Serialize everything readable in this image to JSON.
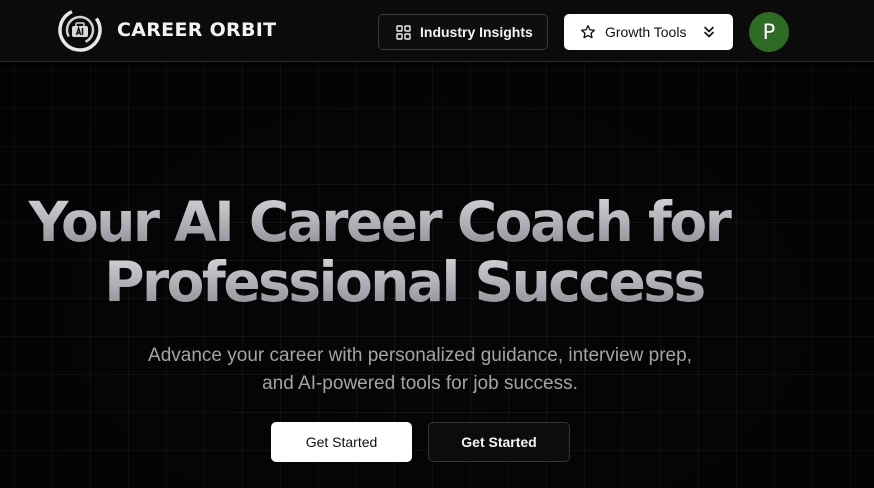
{
  "header": {
    "brand": "CAREER ORBIT",
    "nav": {
      "insights_label": "Industry Insights",
      "growth_label": "Growth Tools"
    },
    "avatar_initial": "P",
    "avatar_color": "#2e6b24"
  },
  "hero": {
    "title_line1": "Your AI Career Coach for",
    "title_line2": "Professional Success",
    "subtitle": "Advance your career with personalized guidance, interview prep, and AI-powered tools for job success.",
    "cta_primary": "Get Started",
    "cta_secondary": "Get Started"
  },
  "icons": {
    "logo": "career-orbit-logo",
    "insights": "layout-grid-icon",
    "growth": "star-icon",
    "dropdown": "chevrons-down-icon"
  }
}
